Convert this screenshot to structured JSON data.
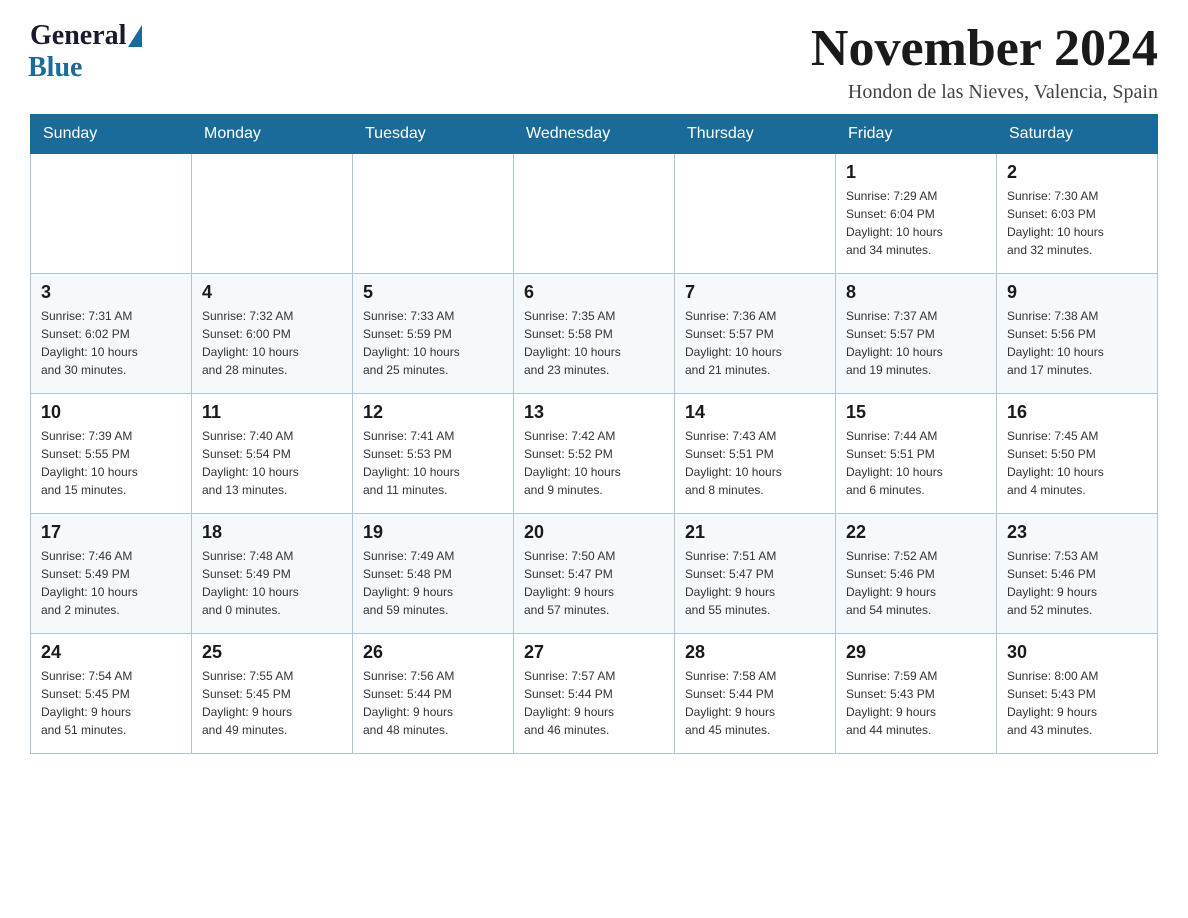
{
  "header": {
    "logo_general": "General",
    "logo_blue": "Blue",
    "month_title": "November 2024",
    "location": "Hondon de las Nieves, Valencia, Spain"
  },
  "days_of_week": [
    "Sunday",
    "Monday",
    "Tuesday",
    "Wednesday",
    "Thursday",
    "Friday",
    "Saturday"
  ],
  "weeks": [
    [
      {
        "day": "",
        "info": ""
      },
      {
        "day": "",
        "info": ""
      },
      {
        "day": "",
        "info": ""
      },
      {
        "day": "",
        "info": ""
      },
      {
        "day": "",
        "info": ""
      },
      {
        "day": "1",
        "info": "Sunrise: 7:29 AM\nSunset: 6:04 PM\nDaylight: 10 hours\nand 34 minutes."
      },
      {
        "day": "2",
        "info": "Sunrise: 7:30 AM\nSunset: 6:03 PM\nDaylight: 10 hours\nand 32 minutes."
      }
    ],
    [
      {
        "day": "3",
        "info": "Sunrise: 7:31 AM\nSunset: 6:02 PM\nDaylight: 10 hours\nand 30 minutes."
      },
      {
        "day": "4",
        "info": "Sunrise: 7:32 AM\nSunset: 6:00 PM\nDaylight: 10 hours\nand 28 minutes."
      },
      {
        "day": "5",
        "info": "Sunrise: 7:33 AM\nSunset: 5:59 PM\nDaylight: 10 hours\nand 25 minutes."
      },
      {
        "day": "6",
        "info": "Sunrise: 7:35 AM\nSunset: 5:58 PM\nDaylight: 10 hours\nand 23 minutes."
      },
      {
        "day": "7",
        "info": "Sunrise: 7:36 AM\nSunset: 5:57 PM\nDaylight: 10 hours\nand 21 minutes."
      },
      {
        "day": "8",
        "info": "Sunrise: 7:37 AM\nSunset: 5:57 PM\nDaylight: 10 hours\nand 19 minutes."
      },
      {
        "day": "9",
        "info": "Sunrise: 7:38 AM\nSunset: 5:56 PM\nDaylight: 10 hours\nand 17 minutes."
      }
    ],
    [
      {
        "day": "10",
        "info": "Sunrise: 7:39 AM\nSunset: 5:55 PM\nDaylight: 10 hours\nand 15 minutes."
      },
      {
        "day": "11",
        "info": "Sunrise: 7:40 AM\nSunset: 5:54 PM\nDaylight: 10 hours\nand 13 minutes."
      },
      {
        "day": "12",
        "info": "Sunrise: 7:41 AM\nSunset: 5:53 PM\nDaylight: 10 hours\nand 11 minutes."
      },
      {
        "day": "13",
        "info": "Sunrise: 7:42 AM\nSunset: 5:52 PM\nDaylight: 10 hours\nand 9 minutes."
      },
      {
        "day": "14",
        "info": "Sunrise: 7:43 AM\nSunset: 5:51 PM\nDaylight: 10 hours\nand 8 minutes."
      },
      {
        "day": "15",
        "info": "Sunrise: 7:44 AM\nSunset: 5:51 PM\nDaylight: 10 hours\nand 6 minutes."
      },
      {
        "day": "16",
        "info": "Sunrise: 7:45 AM\nSunset: 5:50 PM\nDaylight: 10 hours\nand 4 minutes."
      }
    ],
    [
      {
        "day": "17",
        "info": "Sunrise: 7:46 AM\nSunset: 5:49 PM\nDaylight: 10 hours\nand 2 minutes."
      },
      {
        "day": "18",
        "info": "Sunrise: 7:48 AM\nSunset: 5:49 PM\nDaylight: 10 hours\nand 0 minutes."
      },
      {
        "day": "19",
        "info": "Sunrise: 7:49 AM\nSunset: 5:48 PM\nDaylight: 9 hours\nand 59 minutes."
      },
      {
        "day": "20",
        "info": "Sunrise: 7:50 AM\nSunset: 5:47 PM\nDaylight: 9 hours\nand 57 minutes."
      },
      {
        "day": "21",
        "info": "Sunrise: 7:51 AM\nSunset: 5:47 PM\nDaylight: 9 hours\nand 55 minutes."
      },
      {
        "day": "22",
        "info": "Sunrise: 7:52 AM\nSunset: 5:46 PM\nDaylight: 9 hours\nand 54 minutes."
      },
      {
        "day": "23",
        "info": "Sunrise: 7:53 AM\nSunset: 5:46 PM\nDaylight: 9 hours\nand 52 minutes."
      }
    ],
    [
      {
        "day": "24",
        "info": "Sunrise: 7:54 AM\nSunset: 5:45 PM\nDaylight: 9 hours\nand 51 minutes."
      },
      {
        "day": "25",
        "info": "Sunrise: 7:55 AM\nSunset: 5:45 PM\nDaylight: 9 hours\nand 49 minutes."
      },
      {
        "day": "26",
        "info": "Sunrise: 7:56 AM\nSunset: 5:44 PM\nDaylight: 9 hours\nand 48 minutes."
      },
      {
        "day": "27",
        "info": "Sunrise: 7:57 AM\nSunset: 5:44 PM\nDaylight: 9 hours\nand 46 minutes."
      },
      {
        "day": "28",
        "info": "Sunrise: 7:58 AM\nSunset: 5:44 PM\nDaylight: 9 hours\nand 45 minutes."
      },
      {
        "day": "29",
        "info": "Sunrise: 7:59 AM\nSunset: 5:43 PM\nDaylight: 9 hours\nand 44 minutes."
      },
      {
        "day": "30",
        "info": "Sunrise: 8:00 AM\nSunset: 5:43 PM\nDaylight: 9 hours\nand 43 minutes."
      }
    ]
  ]
}
